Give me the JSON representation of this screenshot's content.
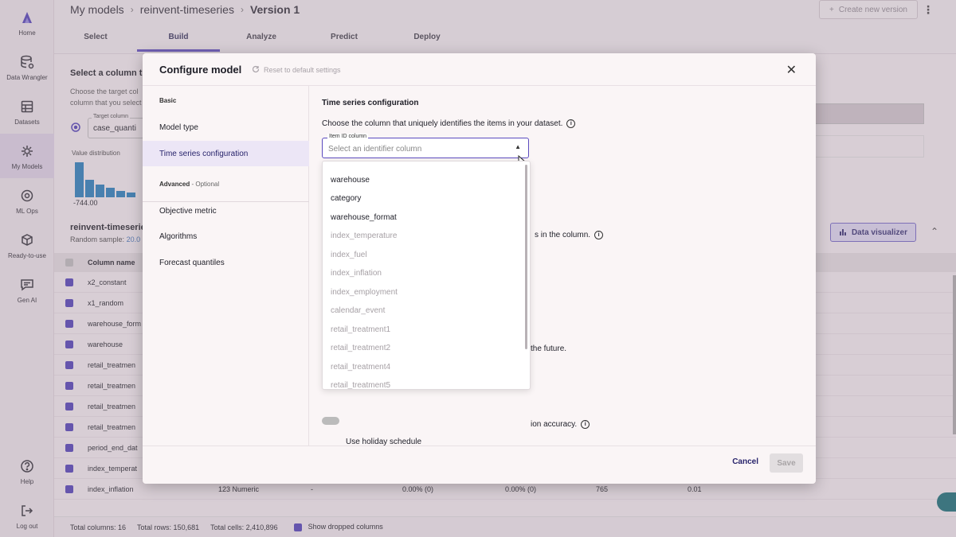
{
  "nav": [
    {
      "label": "Home",
      "icon": "canvas-logo-icon"
    },
    {
      "label": "Data Wrangler",
      "icon": "database-icon"
    },
    {
      "label": "Datasets",
      "icon": "table-icon"
    },
    {
      "label": "My Models",
      "icon": "brain-icon"
    },
    {
      "label": "ML Ops",
      "icon": "gear-icon"
    },
    {
      "label": "Ready-to-use",
      "icon": "package-icon"
    },
    {
      "label": "Gen AI",
      "icon": "chat-icon"
    },
    {
      "label": "Help",
      "icon": "help-icon"
    },
    {
      "label": "Log out",
      "icon": "logout-icon"
    }
  ],
  "header": {
    "breadcrumb": [
      "My models",
      "reinvent-timeseries",
      "Version 1"
    ],
    "new_version": "Create new version",
    "tabs": [
      "Select",
      "Build",
      "Analyze",
      "Predict",
      "Deploy"
    ],
    "active_tab": "Build"
  },
  "background": {
    "heading": "Select a column to",
    "desc_line1": "Choose the target col",
    "desc_line2": "column that you select",
    "target_label": "Target column",
    "target_value": "case_quanti",
    "hist_label": "Value distribution",
    "hist_min": "-744.00",
    "dataset_name": "reinvent-timeseries",
    "sample_label": "Random sample:",
    "sample_value": "20.0",
    "data_visualizer": "Data visualizer",
    "col_header": "Column name",
    "rows": [
      "x2_constant",
      "x1_random",
      "warehouse_form",
      "warehouse",
      "retail_treatmen",
      "retail_treatmen",
      "retail_treatmen",
      "retail_treatmen",
      "period_end_dat",
      "index_temperat",
      "index_inflation"
    ],
    "inflation_row": {
      "type": "123 Numeric",
      "dash": "-",
      "missing": "0.00% (0)",
      "mismatch": "0.00% (0)",
      "unique": "765",
      "mean": "0.01"
    },
    "footer": {
      "columns": "Total columns: 16",
      "rows": "Total rows: 150,681",
      "cells": "Total cells: 2,410,896",
      "dropped": "Show dropped columns"
    }
  },
  "modal": {
    "title": "Configure model",
    "reset": "Reset to default settings",
    "basic": "Basic",
    "advanced": "Advanced",
    "optional": " - Optional",
    "basic_links": [
      "Model type",
      "Time series configuration"
    ],
    "advanced_links": [
      "Objective metric",
      "Algorithms",
      "Forecast quantiles"
    ],
    "section_title": "Time series configuration",
    "item_desc": "Choose the column that uniquely identifies the items in your dataset.",
    "item_label": "Item ID column",
    "item_placeholder": "Select an identifier column",
    "options_enabled": [
      "warehouse",
      "category",
      "warehouse_format"
    ],
    "options_disabled": [
      "index_temperature",
      "index_fuel",
      "index_inflation",
      "index_employment",
      "calendar_event",
      "retail_treatment1",
      "retail_treatment2",
      "retail_treatment4",
      "retail_treatment5"
    ],
    "partial_1": "s in the column.",
    "partial_2": "the future.",
    "partial_3": "ion accuracy.",
    "holiday": "Use holiday schedule",
    "cancel": "Cancel",
    "save": "Save"
  }
}
